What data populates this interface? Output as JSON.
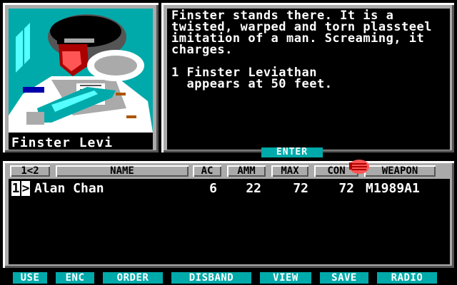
{
  "portrait": {
    "name": "Finster Levi"
  },
  "message": {
    "paragraphs": [
      "Finster stands there. It is a twisted, warped and torn plassteel imitation of a man. Screaming, it charges.",
      "1 Finster Leviathan\n  appears at 50 feet."
    ]
  },
  "enter_label": "ENTER",
  "party": {
    "headers": {
      "page": "1<2",
      "name": "NAME",
      "ac": "AC",
      "amm": "AMM",
      "max": "MAX",
      "con": "CON",
      "weapon": "WEAPON"
    },
    "rows": [
      {
        "num": "1",
        "marker": ">",
        "name": "Alan Chan",
        "ac": "6",
        "amm": "22",
        "max": "72",
        "con": "72",
        "weapon": "M1989A1"
      }
    ]
  },
  "commands": [
    "USE",
    "ENC",
    "ORDER",
    "DISBAND",
    "VIEW",
    "SAVE",
    "RADIO"
  ],
  "colors": {
    "frame_grey": "#aaaaaa",
    "accent_cyan": "#00aaaa",
    "text_white": "#ffffff",
    "cursor_red": "#ff5555"
  },
  "icons": {
    "cursor": "red-gauntlet-hand-cursor"
  }
}
